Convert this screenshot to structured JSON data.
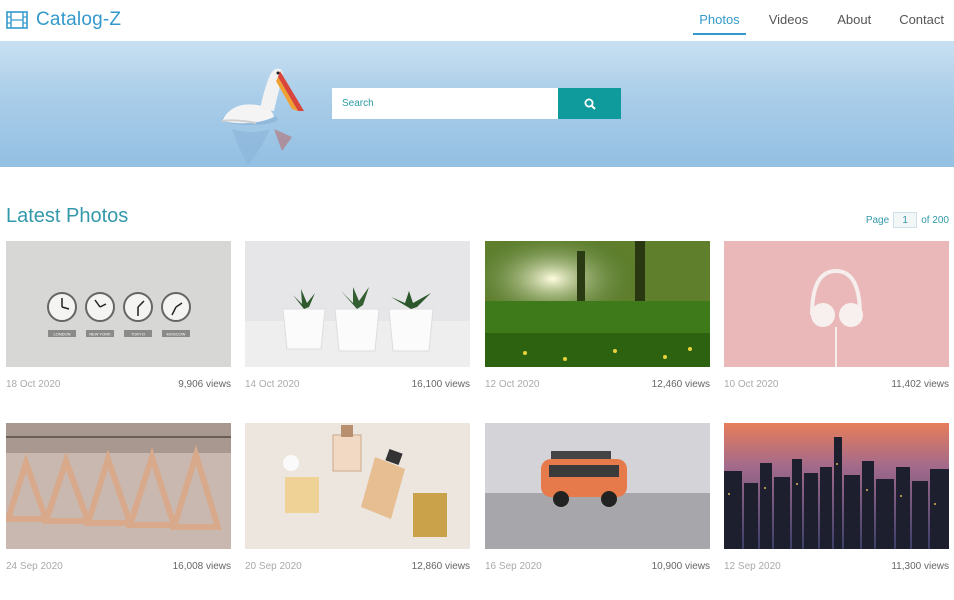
{
  "header": {
    "brand": "Catalog-Z",
    "brand_icon": "film-icon",
    "nav": [
      {
        "label": "Photos",
        "active": true
      },
      {
        "label": "Videos",
        "active": false
      },
      {
        "label": "About",
        "active": false
      },
      {
        "label": "Contact",
        "active": false
      }
    ]
  },
  "hero": {
    "search_placeholder": "Search",
    "search_icon": "search-icon"
  },
  "section": {
    "title": "Latest Photos",
    "page_label": "Page",
    "page_current": "1",
    "page_total": "of 200"
  },
  "photos": [
    {
      "date": "18 Oct 2020",
      "views": "9,906 views"
    },
    {
      "date": "14 Oct 2020",
      "views": "16,100 views"
    },
    {
      "date": "12 Oct 2020",
      "views": "12,460 views"
    },
    {
      "date": "10 Oct 2020",
      "views": "11,402 views"
    },
    {
      "date": "24 Sep 2020",
      "views": "16,008 views"
    },
    {
      "date": "20 Sep 2020",
      "views": "12,860 views"
    },
    {
      "date": "16 Sep 2020",
      "views": "10,900 views"
    },
    {
      "date": "12 Sep 2020",
      "views": "11,300 views"
    }
  ],
  "clock_labels": [
    "LONDON",
    "NEW YORK",
    "TOKYO",
    "MOSCOW"
  ],
  "colors": {
    "accent": "#3399cc",
    "teal": "#0f9b9b"
  }
}
